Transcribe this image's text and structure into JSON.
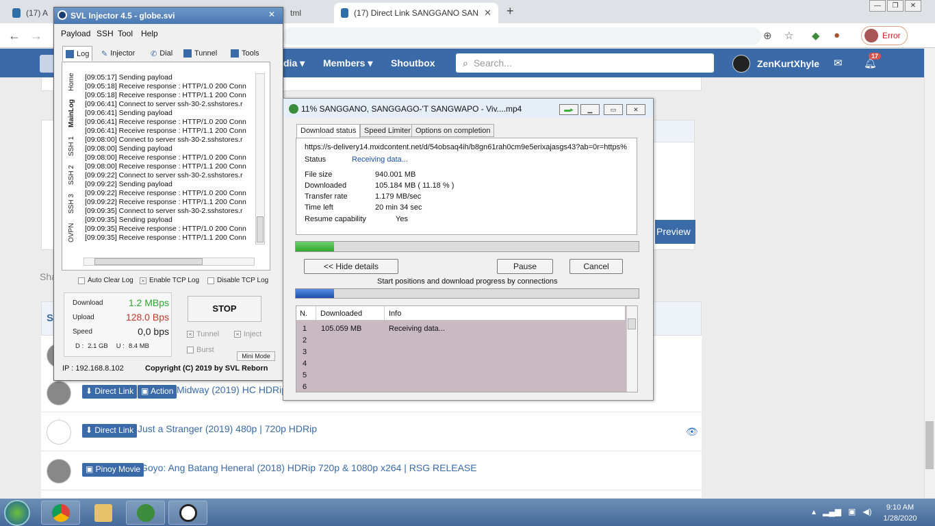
{
  "browser": {
    "tabs": [
      {
        "label": "(17) A"
      },
      {
        "label": "tml"
      },
      {
        "label": "(17) Direct Link SANGGANO SAN",
        "active": true
      }
    ],
    "new_tab": "+",
    "error_label": "Error",
    "window_controls": [
      "—",
      "❐",
      "✕"
    ]
  },
  "site": {
    "nav": {
      "partial": "dia",
      "members": "Members",
      "shoutbox": "Shoutbox"
    },
    "search_placeholder": "Search...",
    "username": "ZenKurtXhyle",
    "notif_count": "17",
    "preview_label": "Preview",
    "partial_sha": "Sha",
    "partial_s": "S",
    "rows": [
      {
        "tags": [
          "Direct Link",
          "Action"
        ],
        "title": "Midway (2019) HC HDRip"
      },
      {
        "tags": [
          "Direct Link"
        ],
        "title": "Just a Stranger (2019) 480p | 720p HDRip"
      },
      {
        "tags": [
          "Pinoy Movie"
        ],
        "title": "Goyo: Ang Batang Heneral (2018) HDRip 720p & 1080p x264 | RSG RELEASE"
      }
    ]
  },
  "svl": {
    "title": "SVL Injector 4.5 - globe.svi",
    "menu": [
      "Payload",
      "SSH",
      "Tool",
      "Help"
    ],
    "tabs": [
      "Log",
      "Injector",
      "Dial",
      "Tunnel",
      "Tools"
    ],
    "side_tabs": [
      "Home",
      "MainLog",
      "SSH 1",
      "SSH 2",
      "SSH 3",
      "OVPN"
    ],
    "log": [
      "[09:05:17] Sending payload",
      "[09:05:18] Receive response : HTTP/1.0 200 Conn",
      "[09:05:18] Receive response : HTTP/1.1 200 Conn",
      "[09:06:41] Connect to server ssh-30-2.sshstores.r",
      "[09:06:41] Sending payload",
      "[09:06:41] Receive response : HTTP/1.0 200 Conn",
      "[09:06:41] Receive response : HTTP/1.1 200 Conn",
      "[09:08:00] Connect to server ssh-30-2.sshstores.r",
      "[09:08:00] Sending payload",
      "[09:08:00] Receive response : HTTP/1.0 200 Conn",
      "[09:08:00] Receive response : HTTP/1.1 200 Conn",
      "[09:09:22] Connect to server ssh-30-2.sshstores.r",
      "[09:09:22] Sending payload",
      "[09:09:22] Receive response : HTTP/1.0 200 Conn",
      "[09:09:22] Receive response : HTTP/1.1 200 Conn",
      "[09:09:35] Connect to server ssh-30-2.sshstores.r",
      "[09:09:35] Sending payload",
      "[09:09:35] Receive response : HTTP/1.0 200 Conn",
      "[09:09:35] Receive response : HTTP/1.1 200 Conn"
    ],
    "checks": {
      "auto_clear": "Auto Clear Log",
      "enable_tcp": "Enable TCP Log",
      "disable_tcp": "Disable TCP Log"
    },
    "stats": {
      "download_label": "Download",
      "download_value": "1.2 MBps",
      "upload_label": "Upload",
      "upload_value": "128.0 Bps",
      "speed_label": "Speed",
      "speed_value": "0,0 bps",
      "d_label": "D :",
      "d_value": "2.1 GB",
      "u_label": "U :",
      "u_value": "8.4 MB"
    },
    "stop_label": "STOP",
    "options": {
      "tunnel": "Tunnel",
      "inject": "Inject",
      "burst": "Burst"
    },
    "mini_mode": "Mini Mode",
    "ip": "IP : 192.168.8.102",
    "copyright": "Copyright (C) 2019 by SVL Reborn"
  },
  "idm": {
    "title": "11% SANGGANO, SANGGAGO-'T SANGWAPO - Viv....mp4",
    "tabs": [
      "Download status",
      "Speed Limiter",
      "Options on completion"
    ],
    "url": "https://s-delivery14.mxdcontent.net/d/54obsaq4ih/b8gn61rah0cm9e5erixajasgs43?ab=0r=https%",
    "status_label": "Status",
    "status_value": "Receiving data...",
    "file_size_label": "File size",
    "file_size_value": "940.001  MB",
    "downloaded_label": "Downloaded",
    "downloaded_value": "105.184  MB  ( 11.18 % )",
    "transfer_label": "Transfer rate",
    "transfer_value": "1.179  MB/sec",
    "time_left_label": "Time left",
    "time_left_value": "20 min 34 sec",
    "resume_label": "Resume capability",
    "resume_value": "Yes",
    "progress": 0.1118,
    "buttons": {
      "hide": "<< Hide details",
      "pause": "Pause",
      "cancel": "Cancel"
    },
    "start_positions": "Start positions and download progress by connections",
    "columns": [
      "N.",
      "Downloaded",
      "Info"
    ],
    "connections": [
      {
        "n": "1",
        "downloaded": "105.059  MB",
        "info": "Receiving data..."
      },
      {
        "n": "2"
      },
      {
        "n": "3"
      },
      {
        "n": "4"
      },
      {
        "n": "5"
      },
      {
        "n": "6"
      }
    ]
  },
  "taskbar": {
    "time": "9:10 AM",
    "date": "1/28/2020"
  },
  "colors": {
    "site_blue": "#3a6aa8",
    "download_green": "#2ea52e",
    "upload_red": "#c0392b"
  }
}
